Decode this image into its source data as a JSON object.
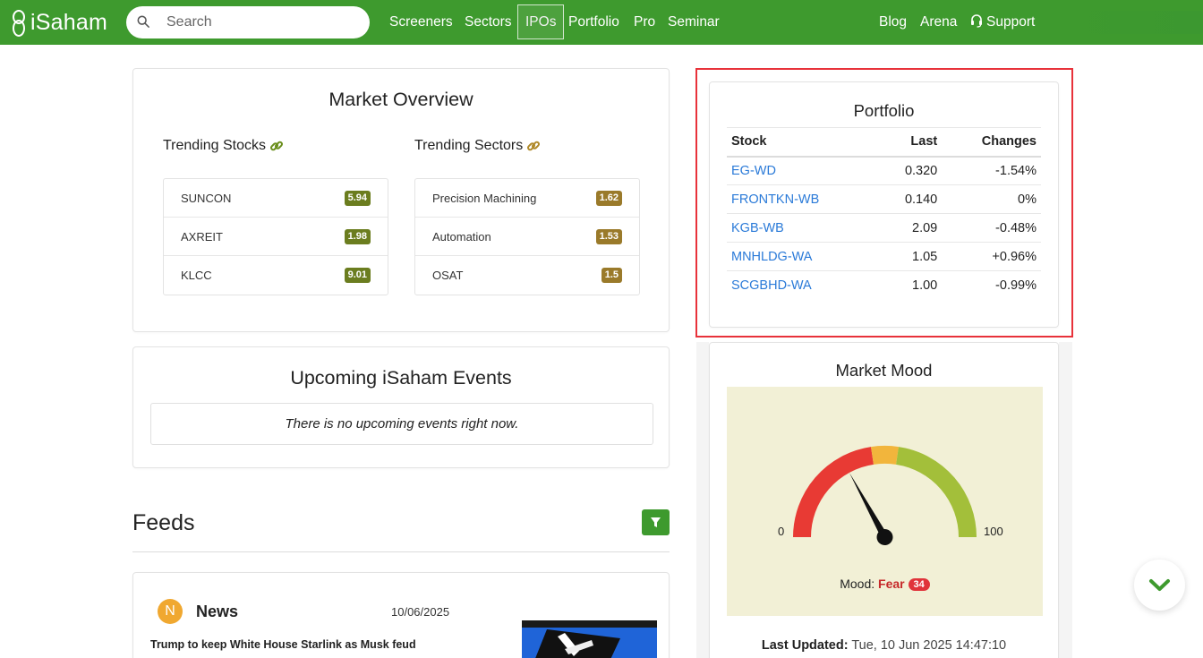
{
  "nav": {
    "logo": "iSaham",
    "search_placeholder": "Search",
    "links": [
      "Screeners",
      "Sectors",
      "IPOs",
      "Portfolio",
      "Pro",
      "Seminar"
    ],
    "right_links": [
      "Blog",
      "Arena",
      "Support"
    ],
    "active": "IPOs"
  },
  "market_overview": {
    "title": "Market Overview",
    "trending_stocks": {
      "label": "Trending Stocks",
      "items": [
        {
          "name": "SUNCON",
          "value": "5.94"
        },
        {
          "name": "AXREIT",
          "value": "1.98"
        },
        {
          "name": "KLCC",
          "value": "9.01"
        }
      ]
    },
    "trending_sectors": {
      "label": "Trending Sectors",
      "items": [
        {
          "name": "Precision Machining",
          "value": "1.62"
        },
        {
          "name": "Automation",
          "value": "1.53"
        },
        {
          "name": "OSAT",
          "value": "1.5"
        }
      ]
    },
    "stock_badge_color": "#6b7d1f",
    "sector_badge_color": "#9a7a2a"
  },
  "events": {
    "title": "Upcoming iSaham Events",
    "empty_text": "There is no upcoming events right now."
  },
  "feeds": {
    "title": "Feeds",
    "news": {
      "avatar": "N",
      "title": "News",
      "date": "10/06/2025",
      "headline": "Trump to keep White House Starlink as Musk feud"
    }
  },
  "portfolio": {
    "title": "Portfolio",
    "columns": [
      "Stock",
      "Last",
      "Changes"
    ],
    "rows": [
      {
        "stock": "EG-WD",
        "last": "0.320",
        "change": "-1.54%",
        "dir": "neg"
      },
      {
        "stock": "FRONTKN-WB",
        "last": "0.140",
        "change": "0%",
        "dir": "zero"
      },
      {
        "stock": "KGB-WB",
        "last": "2.09",
        "change": "-0.48%",
        "dir": "neg"
      },
      {
        "stock": "MNHLDG-WA",
        "last": "1.05",
        "change": "+0.96%",
        "dir": "pos"
      },
      {
        "stock": "SCGBHD-WA",
        "last": "1.00",
        "change": "-0.99%",
        "dir": "neg"
      }
    ]
  },
  "market_mood": {
    "title": "Market Mood",
    "min_label": "0",
    "max_label": "100",
    "mood_label": "Mood:",
    "mood_value": "Fear",
    "score": "34",
    "score_value": 34,
    "updated_label": "Last Updated:",
    "updated_value": "Tue, 10 Jun 2025 14:47:10",
    "colors": {
      "fear": "#e83a34",
      "neutral": "#f2b53c",
      "greed": "#a3bf3a"
    }
  },
  "colors": {
    "brand": "#3e9a2e",
    "link": "#2a7ad8",
    "negative": "#e0333a",
    "positive": "#2d9a2d",
    "highlight": "#e8323a"
  }
}
